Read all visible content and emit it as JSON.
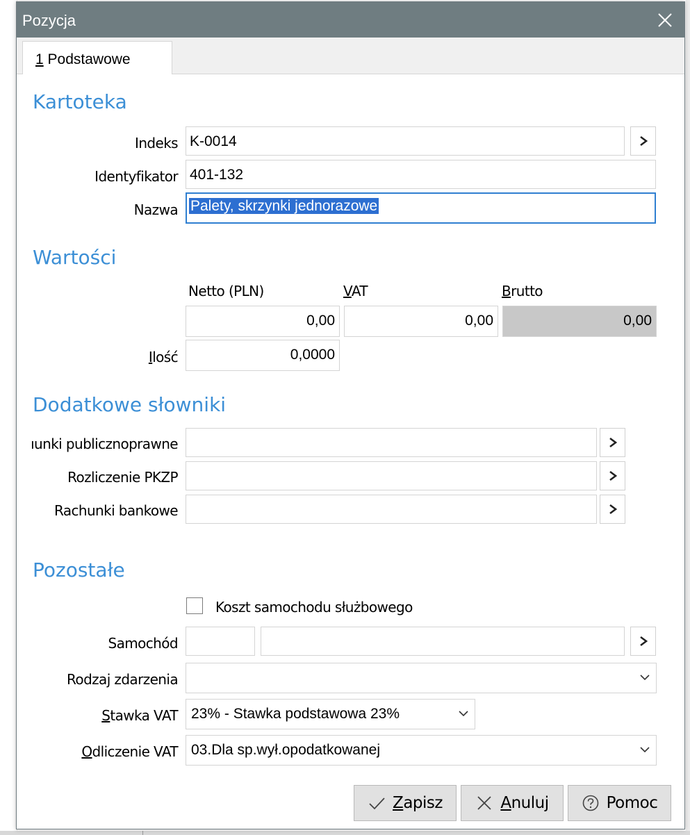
{
  "window": {
    "title": "Pozycja"
  },
  "tabs": [
    {
      "mnemonic": "1",
      "label": " Podstawowe"
    }
  ],
  "kartoteka": {
    "title": "Kartoteka",
    "indeks_label": "Indeks",
    "indeks_value": "K-0014",
    "identyfikator_label": "Identyfikator",
    "identyfikator_value": "401-132",
    "nazwa_label": "Nazwa",
    "nazwa_value": "Palety, skrzynki jednorazowe"
  },
  "wartosci": {
    "title": "Wartości",
    "netto_label": "Netto (PLN)",
    "vat_mnemonic": "V",
    "vat_rest": "AT",
    "brutto_mnemonic": "B",
    "brutto_rest": "rutto",
    "netto_value": "0,00",
    "vat_value": "0,00",
    "brutto_value": "0,00",
    "ilosc_mnemonic": "I",
    "ilosc_rest": "lość",
    "ilosc_value": "0,0000"
  },
  "slowniki": {
    "title": "Dodatkowe słowniki",
    "rows": [
      {
        "label": "ıunki publicznoprawne",
        "value": ""
      },
      {
        "label": "Rozliczenie PKZP",
        "value": ""
      },
      {
        "label": "Rachunki bankowe",
        "value": ""
      }
    ]
  },
  "pozostale": {
    "title": "Pozostałe",
    "koszt_label": "Koszt samochodu służbowego",
    "koszt_checked": false,
    "samochod_label": "Samochód",
    "samochod_code": "",
    "samochod_name": "",
    "rodzaj_label": "Rodzaj zdarzenia",
    "rodzaj_value": "",
    "stawka_mnemonic": "S",
    "stawka_rest": "tawka VAT",
    "stawka_value": "23% - Stawka podstawowa 23%",
    "odliczenie_mnemonic": "O",
    "odliczenie_rest": "dliczenie VAT",
    "odliczenie_value": "03.Dla sp.wył.opodatkowanej"
  },
  "buttons": {
    "zapisz_mnemonic": "Z",
    "zapisz_rest": "apisz",
    "anuluj_mnemonic": "A",
    "anuluj_rest": "nuluj",
    "pomoc": "Pomoc"
  },
  "colors": {
    "accent": "#3c8fd6",
    "titlebar": "#6f7d81",
    "selection": "#2d6fd1"
  },
  "icons": [
    "close-icon",
    "chevron-right-icon",
    "chevron-down-icon",
    "check-icon",
    "x-icon",
    "question-circle-icon"
  ]
}
